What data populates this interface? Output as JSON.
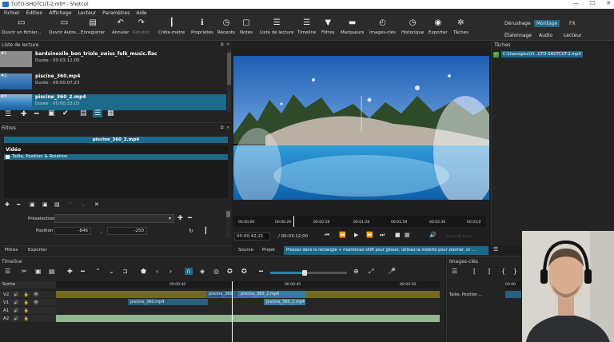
{
  "window": {
    "title": "TUTO-SHOTCUT-2.mlt* - Shotcut",
    "controls": [
      "—",
      "☐",
      "✕"
    ]
  },
  "menu": [
    "Fichier",
    "Édition",
    "Affichage",
    "Lecteur",
    "Paramètres",
    "Aide"
  ],
  "toolbar": [
    {
      "label": "Ouvrir un fichier...",
      "icon": "folder-open-icon",
      "glyph": "▭"
    },
    {
      "label": "Ouvrir Autre...",
      "icon": "open-other-icon",
      "glyph": "▭"
    },
    {
      "label": "Enregistrer",
      "icon": "save-icon",
      "glyph": "▤"
    },
    {
      "label": "Annuler",
      "icon": "undo-icon",
      "glyph": "↶"
    },
    {
      "label": "Rétablir",
      "icon": "redo-icon",
      "glyph": "↷"
    },
    {
      "label": "Crête-mètre",
      "icon": "peak-meter-icon",
      "glyph": "┃"
    },
    {
      "label": "Propriétés",
      "icon": "info-icon",
      "glyph": "ℹ"
    },
    {
      "label": "Récents",
      "icon": "recent-icon",
      "glyph": "◷"
    },
    {
      "label": "Notes",
      "icon": "notes-icon",
      "glyph": "▢"
    },
    {
      "label": "Liste de lecture",
      "icon": "playlist-icon",
      "glyph": "☰"
    },
    {
      "label": "Timeline",
      "icon": "timeline-icon",
      "glyph": "☰"
    },
    {
      "label": "Filtres",
      "icon": "filter-icon",
      "glyph": "▼"
    },
    {
      "label": "Marqueurs",
      "icon": "marker-icon",
      "glyph": "▬"
    },
    {
      "label": "Images-clés",
      "icon": "keyframes-icon",
      "glyph": "◴"
    },
    {
      "label": "Historique",
      "icon": "history-icon",
      "glyph": "◷"
    },
    {
      "label": "Exporter",
      "icon": "export-icon",
      "glyph": "◉"
    },
    {
      "label": "Tâches",
      "icon": "jobs-icon",
      "glyph": "✲"
    }
  ],
  "layouts": [
    "Dérushage",
    "Montage",
    "FX",
    "Étalonnage",
    "Audio",
    "Lecteur"
  ],
  "playlist": {
    "title": "Liste de lecture",
    "items": [
      {
        "name": "bardsinexile_bon_triole_swiss_folk_music.flac",
        "duration": "Durée : 00:03:12;00",
        "badge": "#1"
      },
      {
        "name": "piscine_360.mp4",
        "duration": "Durée : 00:00:07;23",
        "badge": "#2"
      },
      {
        "name": "piscine_360_2.mp4",
        "duration": "Durée : 00:00:33;03",
        "badge": "#3"
      }
    ]
  },
  "filters": {
    "title": "Filtres",
    "clip_name": "piscine_360_2.mp4",
    "section": "Vidéo",
    "items": [
      "Taille, Position & Rotation"
    ],
    "preset_label": "Préselection",
    "position_label": "Position",
    "pos_x": "-846",
    "pos_y": "-250",
    "comma": ","
  },
  "tabs_left": [
    "Filtres",
    "Exporter"
  ],
  "player": {
    "timecode": "00:00:42;21",
    "duration": "/ 00:03:12;00",
    "ruler": [
      "00:00:00",
      "00:00:20",
      "00:00:58",
      "00:01:26",
      "00:01:59",
      "00:02:30",
      "00:03:0"
    ],
    "in_out": "-:-:-:-- / -:-:-:--",
    "tabs": [
      "Source",
      "Projet"
    ],
    "hint": "Pressez dans le rectangle + maintenez shift pour glisser, utilisez la molette pour zoomer, or ..."
  },
  "jobs": {
    "title": "Tâches",
    "items": [
      "C:\\Users\\picc\\Vi...UTO-SHOTCUT-2.mp4"
    ]
  },
  "timeline": {
    "title": "Timeline",
    "output_label": "Sortie",
    "ruler": [
      "00:00:40",
      "00:00:45",
      "00:00:50"
    ],
    "tracks": [
      "V2",
      "V1",
      "A1",
      "A2"
    ],
    "clips_v2": [
      "piscine_360",
      "piscine_360_2.mp4"
    ],
    "clips_v1": [
      "piscine_360.mp4",
      "piscine_360_2.mp4"
    ]
  },
  "keyframes": {
    "title": "Images-clés",
    "track_label": "Taille, Position ...",
    "ruler": "00:00"
  },
  "colors": {
    "accent": "#1b6a8a",
    "highlight": "#2a82a6",
    "track_v2": "#706a25",
    "clip_blue": "#2c5e7e",
    "audio_green": "#93b592"
  }
}
